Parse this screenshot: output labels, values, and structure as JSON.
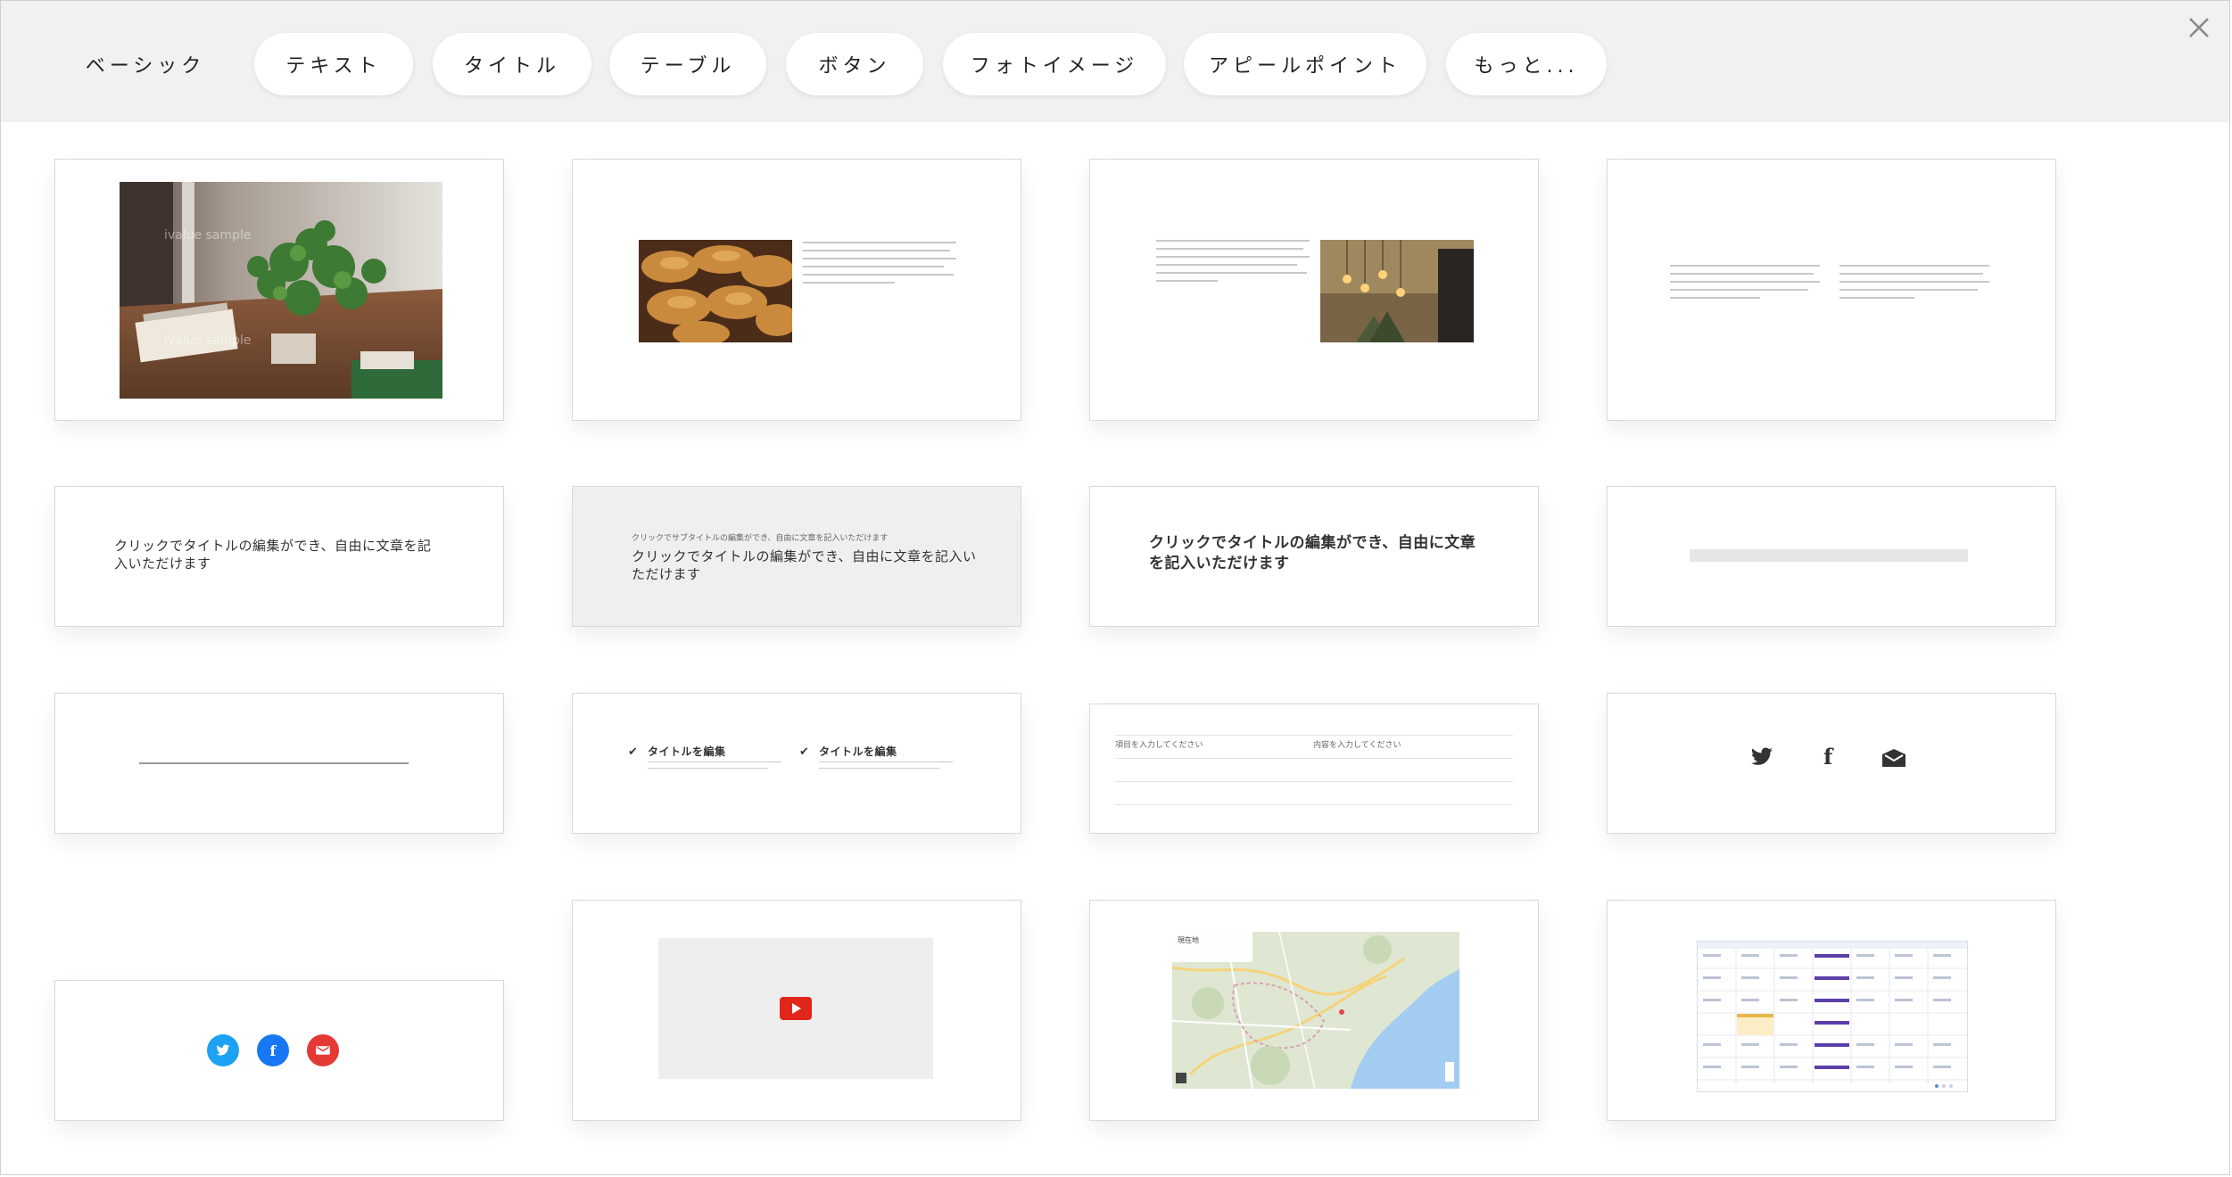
{
  "tabs": [
    {
      "label": "ベーシック"
    },
    {
      "label": "テキスト"
    },
    {
      "label": "タイトル"
    },
    {
      "label": "テーブル"
    },
    {
      "label": "ボタン"
    },
    {
      "label": "フォトイメージ"
    },
    {
      "label": "アピールポイント"
    },
    {
      "label": "もっと..."
    }
  ],
  "icons": {
    "close": "close-icon"
  },
  "cards": {
    "photo_watermark": "ivalue sample",
    "title_1": "クリックでタイトルの編集ができ、自由に文章を記入いただけます",
    "title_2_sub": "クリックでサブタイトルの編集ができ、自由に文章を記入いただけます",
    "title_2": "クリックでタイトルの編集ができ、自由に文章を記入いただけます",
    "title_3": "クリックでタイトルの編集ができ、自由に文章を記入いただけます",
    "feature_1_title": "タイトルを編集",
    "feature_2_title": "タイトルを編集",
    "table_cell_1": "項目を入力してください",
    "table_cell_2": "内容を入力してください",
    "social_f": "f",
    "map_label": "現在地"
  },
  "colors": {
    "twitter": "#1da1f2",
    "facebook": "#1877f2",
    "mail": "#e53935",
    "youtube": "#e0261b",
    "calendar_accent": "#5b3fa8"
  }
}
